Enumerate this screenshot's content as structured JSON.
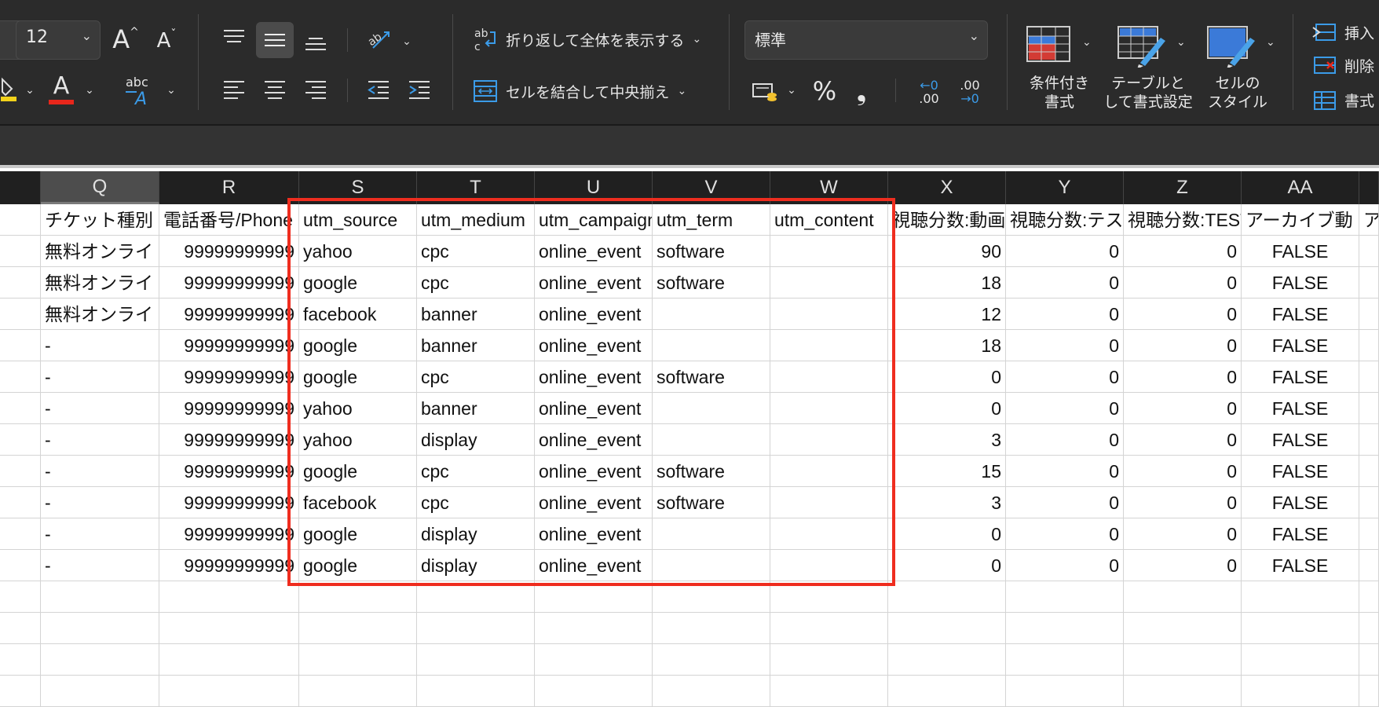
{
  "ribbon": {
    "font_size": "12",
    "grow_font": "A",
    "shrink_font": "A",
    "font_color_letter": "A",
    "text_direction_label": "abc",
    "wrap_text": "折り返して全体を表示する",
    "merge_center": "セルを結合して中央揃え",
    "number_format": "標準",
    "percent": "%",
    "comma": "❟",
    "increase_decimal_top": "←0",
    "increase_decimal_bottom": ".00",
    "decrease_decimal_top": ".00",
    "decrease_decimal_bottom": "→0",
    "conditional_format_line1": "条件付き",
    "conditional_format_line2": "書式",
    "table_format_line1": "テーブルと",
    "table_format_line2": "して書式設定",
    "cell_style_line1": "セルの",
    "cell_style_line2": "スタイル",
    "insert": "挿入",
    "delete": "削除",
    "format": "書式",
    "colors": {
      "ribbon_bg": "#2b2b2b",
      "accent_red": "#e8261b",
      "accent_yellow": "#f2d21b",
      "icon_blue": "#3b9be8"
    }
  },
  "columns": [
    "Q",
    "R",
    "S",
    "T",
    "U",
    "V",
    "W",
    "X",
    "Y",
    "Z",
    "AA"
  ],
  "selected_column": "Q",
  "header_row": [
    "チケット種別",
    "電話番号/Phone",
    "utm_source",
    "utm_medium",
    "utm_campaign",
    "utm_term",
    "utm_content",
    "視聴分数:動画",
    "視聴分数:テスト",
    "視聴分数:TEST",
    "アーカイブ動",
    "ア"
  ],
  "rows": [
    [
      "無料オンライ",
      "99999999999",
      "yahoo",
      "cpc",
      "online_event",
      "software",
      "",
      "90",
      "0",
      "0",
      "FALSE"
    ],
    [
      "無料オンライ",
      "99999999999",
      "google",
      "cpc",
      "online_event",
      "software",
      "",
      "18",
      "0",
      "0",
      "FALSE"
    ],
    [
      "無料オンライ",
      "99999999999",
      "facebook",
      "banner",
      "online_event",
      "",
      "",
      "12",
      "0",
      "0",
      "FALSE"
    ],
    [
      "-",
      "99999999999",
      "google",
      "banner",
      "online_event",
      "",
      "",
      "18",
      "0",
      "0",
      "FALSE"
    ],
    [
      "-",
      "99999999999",
      "google",
      "cpc",
      "online_event",
      "software",
      "",
      "0",
      "0",
      "0",
      "FALSE"
    ],
    [
      "-",
      "99999999999",
      "yahoo",
      "banner",
      "online_event",
      "",
      "",
      "0",
      "0",
      "0",
      "FALSE"
    ],
    [
      "-",
      "99999999999",
      "yahoo",
      "display",
      "online_event",
      "",
      "",
      "3",
      "0",
      "0",
      "FALSE"
    ],
    [
      "-",
      "99999999999",
      "google",
      "cpc",
      "online_event",
      "software",
      "",
      "15",
      "0",
      "0",
      "FALSE"
    ],
    [
      "-",
      "99999999999",
      "facebook",
      "cpc",
      "online_event",
      "software",
      "",
      "3",
      "0",
      "0",
      "FALSE"
    ],
    [
      "-",
      "99999999999",
      "google",
      "display",
      "online_event",
      "",
      "",
      "0",
      "0",
      "0",
      "FALSE"
    ],
    [
      "-",
      "99999999999",
      "google",
      "display",
      "online_event",
      "",
      "",
      "0",
      "0",
      "0",
      "FALSE"
    ]
  ],
  "highlight_color": "#ef2d1f"
}
